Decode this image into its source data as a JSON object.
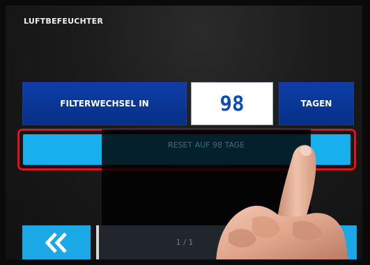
{
  "screen": {
    "title": "LUFTBEFEUCHTER"
  },
  "filter": {
    "label": "FILTERWECHSEL IN",
    "value": "98",
    "unit": "TAGEN"
  },
  "reset": {
    "label": "RESET AUF 98 TAGE"
  },
  "bottom": {
    "back_icon": "double-chevron-left-icon",
    "middle_label": "1 / 1",
    "confirm_icon": "checkmark-icon"
  },
  "colors": {
    "dark_blue": "#0a3a9c",
    "light_blue": "#18b0ec",
    "highlight_red": "#e0141b"
  }
}
